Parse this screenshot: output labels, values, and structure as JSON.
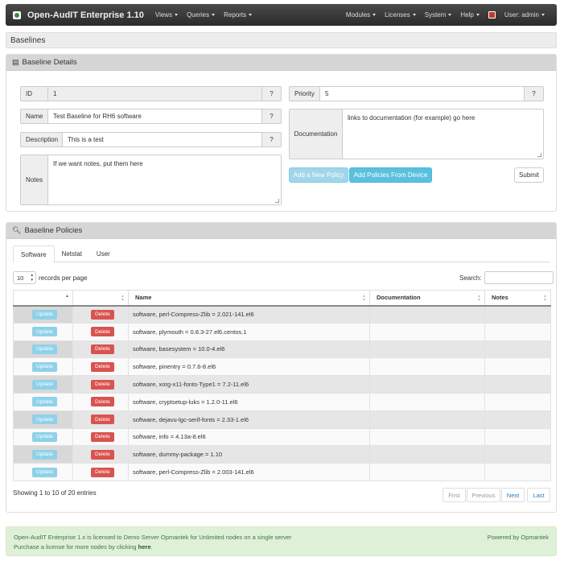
{
  "navbar": {
    "brand": "Open-AudIT Enterprise 1.10",
    "left_menu": [
      {
        "label": "Views"
      },
      {
        "label": "Queries"
      },
      {
        "label": "Reports"
      }
    ],
    "right_menu": [
      {
        "label": "Modules"
      },
      {
        "label": "Licenses"
      },
      {
        "label": "System"
      },
      {
        "label": "Help"
      }
    ],
    "user": "User: admin"
  },
  "page_title": "Baselines",
  "details": {
    "heading": "Baseline Details",
    "id_label": "ID",
    "id_value": "1",
    "name_label": "Name",
    "name_value": "Test Baseline for RH6 software",
    "description_label": "Description",
    "description_value": "This is a test",
    "notes_label": "Notes",
    "notes_value": "If we want notes, put them here",
    "priority_label": "Priority",
    "priority_value": "5",
    "documentation_label": "Documentation",
    "documentation_value": "links to documentation (for example) go here",
    "help": "?",
    "add_policy": "Add a New Policy",
    "add_from_device": "Add Policies From Device",
    "submit": "Submit"
  },
  "policies": {
    "heading": "Baseline Policies",
    "tabs": [
      "Software",
      "Netstat",
      "User"
    ],
    "page_size": "10",
    "records_label": "records per page",
    "search_label": "Search:",
    "columns": [
      "",
      "",
      "Name",
      "Documentation",
      "Notes"
    ],
    "update_label": "Update",
    "delete_label": "Delete",
    "rows": [
      {
        "name": "software, perl-Compress-Zlib = 2.021-141.el6"
      },
      {
        "name": "software, plymouth = 0.8.3-27.el6.centos.1"
      },
      {
        "name": "software, basesystem = 10.0-4.el6"
      },
      {
        "name": "software, pinentry = 0.7.6-8.el6"
      },
      {
        "name": "software, xorg-x11-fonts-Type1 = 7.2-11.el6"
      },
      {
        "name": "software, cryptsetup-luks = 1.2.0-11.el6"
      },
      {
        "name": "software, dejavu-lgc-serif-fonts = 2.33-1.el6"
      },
      {
        "name": "software, info = 4.13a-8.el6"
      },
      {
        "name": "software, dummy-package = 1.10"
      },
      {
        "name": "software, perl-Compress-Zlib = 2.003-141.el6"
      }
    ],
    "info": "Showing 1 to 10 of 20 entries",
    "pager": {
      "first": "First",
      "previous": "Previous",
      "next": "Next",
      "last": "Last"
    }
  },
  "footer": {
    "line1": "Open-AudIT Enterprise 1.x is licensed to Demo Server Opmantek for Unlimited nodes on a single server",
    "line2_prefix": "Purchase a license for more nodes by clicking ",
    "line2_link": "here",
    "line2_suffix": ".",
    "powered": "Powered by Opmantek"
  }
}
